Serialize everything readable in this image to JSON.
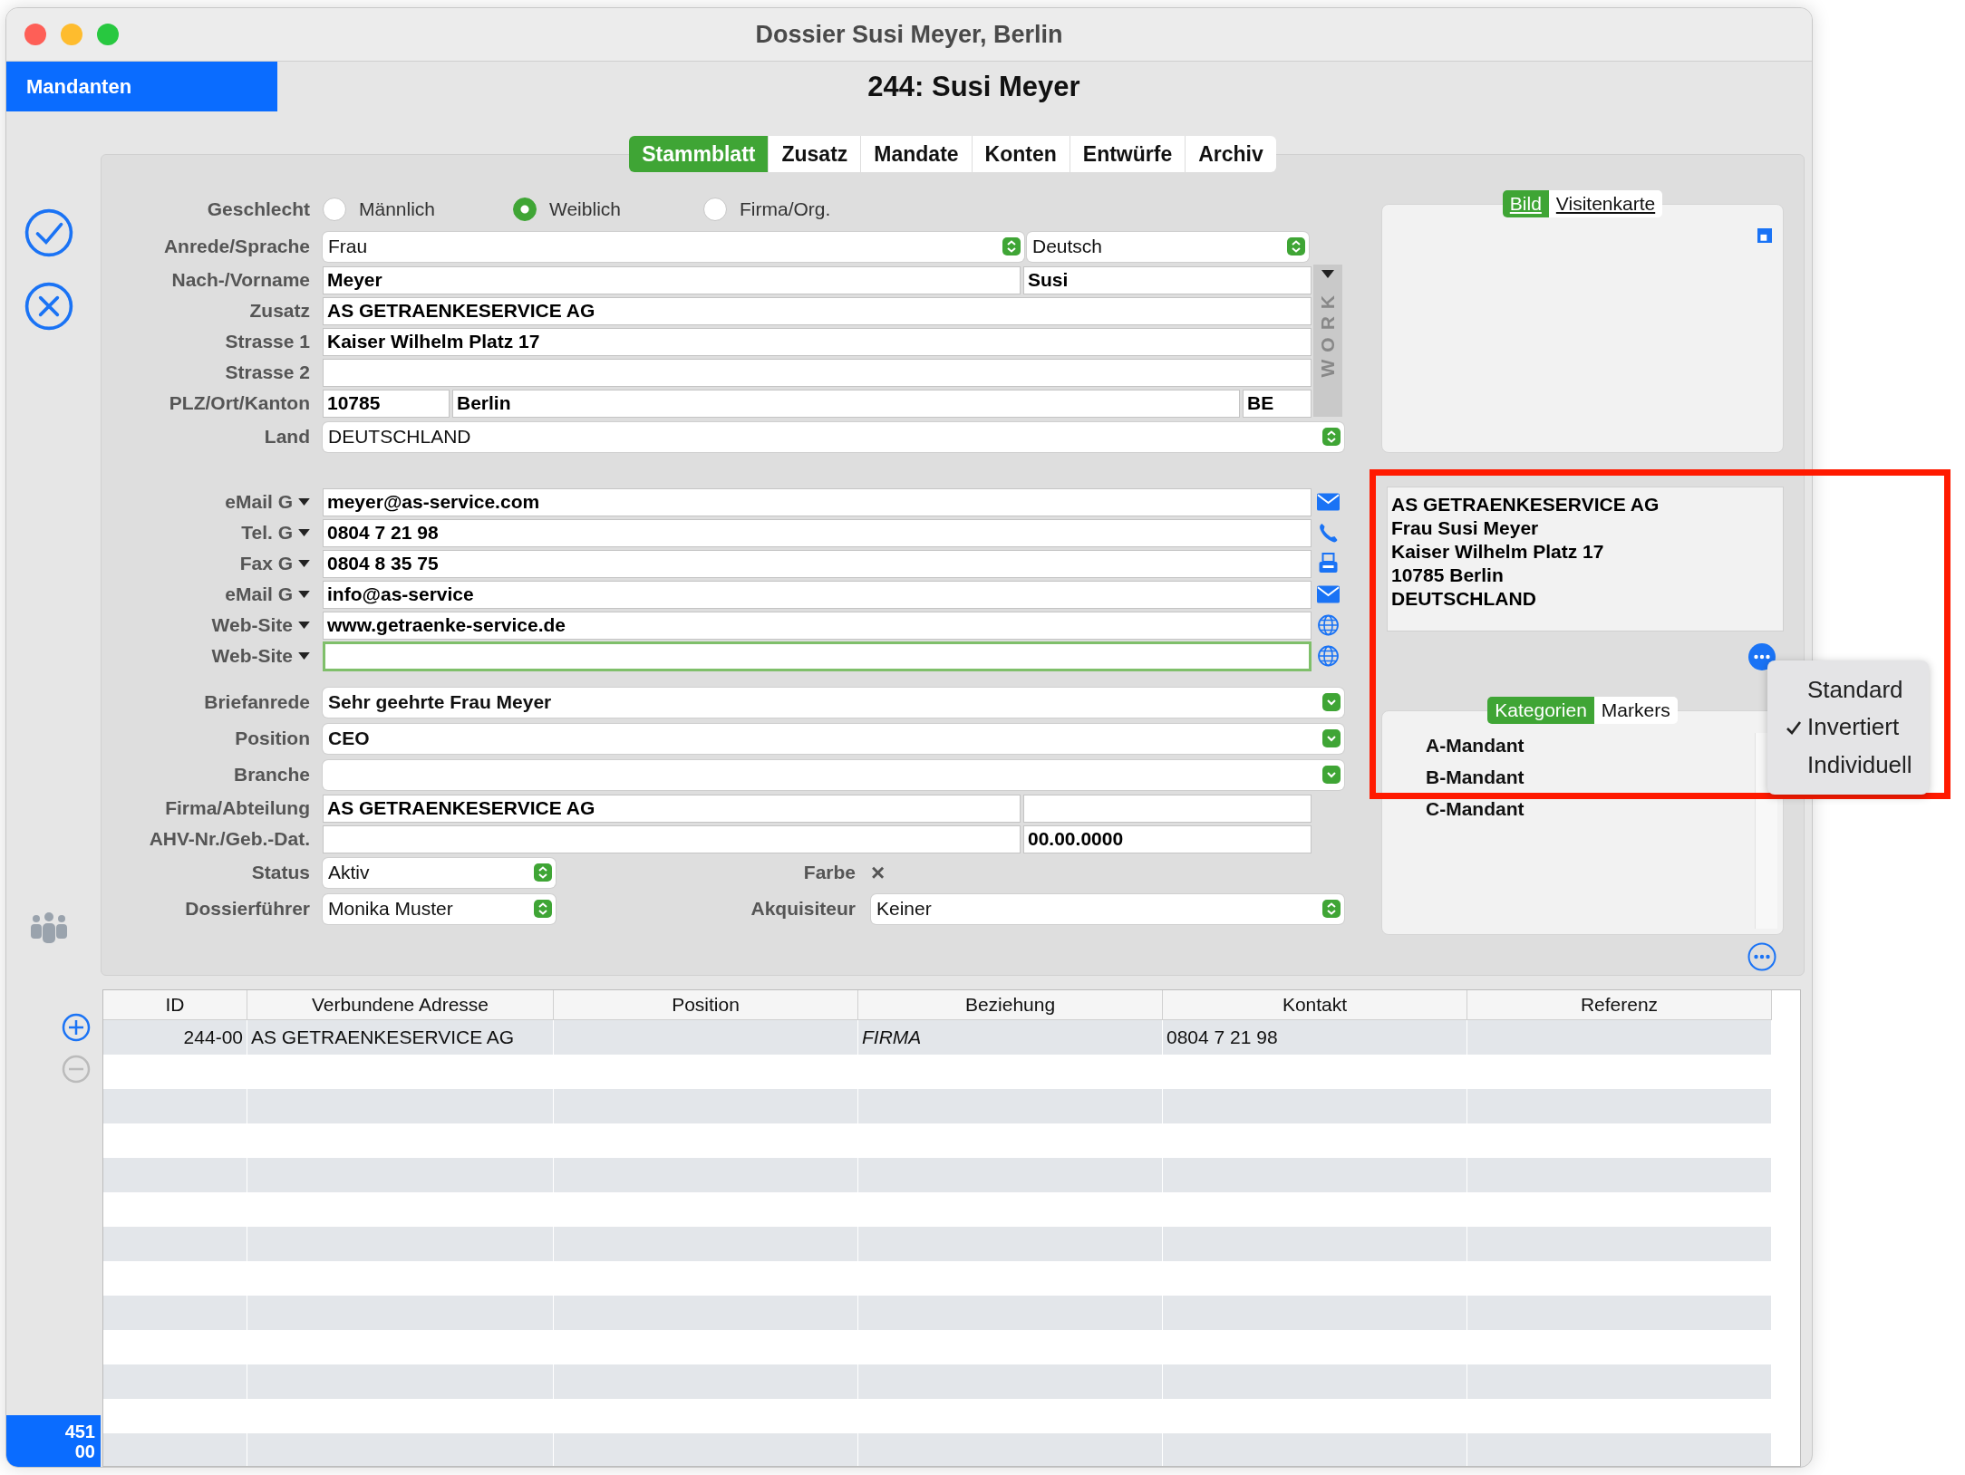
{
  "window": {
    "title": "Dossier Susi Meyer, Berlin"
  },
  "sidebar": {
    "section": "Mandanten",
    "counter": [
      "451",
      "00"
    ]
  },
  "heading": "244: Susi Meyer",
  "tabs": [
    {
      "label": "Stammblatt",
      "selected": true
    },
    {
      "label": "Zusatz",
      "selected": false
    },
    {
      "label": "Mandate",
      "selected": false
    },
    {
      "label": "Konten",
      "selected": false
    },
    {
      "label": "Entwürfe",
      "selected": false
    },
    {
      "label": "Archiv",
      "selected": false
    }
  ],
  "gender": {
    "label": "Geschlecht",
    "options": [
      {
        "label": "Männlich",
        "selected": false
      },
      {
        "label": "Weiblich",
        "selected": true
      },
      {
        "label": "Firma/Org.",
        "selected": false
      }
    ]
  },
  "address_rows": [
    {
      "kind": "select-pair",
      "label": "Anrede/Sprache",
      "value": "Frau",
      "value_2": "Deutsch"
    },
    {
      "kind": "text-pair",
      "label": "Nach-/Vorname",
      "value": "Meyer",
      "value_2": "Susi"
    },
    {
      "kind": "text",
      "label": "Zusatz",
      "value": "AS GETRAENKESERVICE AG"
    },
    {
      "kind": "text",
      "label": "Strasse 1",
      "value": "Kaiser Wilhelm Platz 17"
    },
    {
      "kind": "text",
      "label": "Strasse 2"
    },
    {
      "kind": "zip-city",
      "label": "PLZ/Ort/Kanton",
      "value": "10785",
      "value_2": "Berlin",
      "value_3": "BE"
    },
    {
      "kind": "select",
      "label": "Land",
      "value": "DEUTSCHLAND",
      "bold": false
    }
  ],
  "address_tag": "WORK",
  "contact_rows": [
    {
      "kind": "mail",
      "label": "eMail G",
      "value": "meyer@as-service.com",
      "focused": false
    },
    {
      "kind": "phone",
      "label": "Tel. G",
      "value": "0804 7 21 98",
      "focused": false
    },
    {
      "kind": "fax",
      "label": "Fax G",
      "value": "0804 8 35 75",
      "focused": false
    },
    {
      "kind": "mail",
      "label": "eMail G",
      "value": "info@as-service",
      "focused": false
    },
    {
      "kind": "web",
      "label": "Web-Site",
      "value": "www.getraenke-service.de",
      "focused": false
    },
    {
      "kind": "web",
      "label": "Web-Site",
      "focused": true
    }
  ],
  "detail_rows": [
    {
      "kind": "combo",
      "label": "Briefanrede",
      "value": "Sehr geehrte Frau Meyer",
      "bold": true
    },
    {
      "kind": "combo",
      "label": "Position",
      "value": "CEO",
      "bold": true
    },
    {
      "kind": "combo",
      "label": "Branche"
    },
    {
      "kind": "text-pair",
      "label": "Firma/Abteilung",
      "value": "AS GETRAENKESERVICE AG"
    },
    {
      "kind": "text-pair",
      "label": "AHV-Nr./Geb.-Dat.",
      "value_2": "00.00.0000"
    },
    {
      "kind": "select-mark",
      "label": "Status",
      "value": "Aktiv",
      "label_2": "Farbe",
      "mark": "×"
    },
    {
      "kind": "select-select",
      "label": "Dossierführer",
      "value": "Monika Muster",
      "label_2": "Akquisiteur",
      "value_2": "Keiner"
    }
  ],
  "picture_tabs": [
    {
      "label": "Bild",
      "selected": true
    },
    {
      "label": "Visitenkarte",
      "selected": false
    }
  ],
  "address_block": [
    "AS GETRAENKESERVICE AG",
    "Frau Susi Meyer",
    "Kaiser Wilhelm Platz 17",
    "10785 Berlin",
    "DEUTSCHLAND"
  ],
  "category_tabs": [
    {
      "label": "Kategorien",
      "selected": true
    },
    {
      "label": "Markers",
      "selected": false
    }
  ],
  "categories": [
    "A-Mandant",
    "B-Mandant",
    "C-Mandant"
  ],
  "popup_menu": [
    {
      "label": "Standard",
      "checked": false
    },
    {
      "label": "Invertiert",
      "checked": true
    },
    {
      "label": "Individuell",
      "checked": false
    }
  ],
  "table": {
    "columns": [
      "ID",
      "Verbundene Adresse",
      "Position",
      "Beziehung",
      "Kontakt",
      "Referenz"
    ],
    "rows": [
      {
        "id": "244-00",
        "address": "AS GETRAENKESERVICE AG",
        "relation": "FIRMA",
        "contact": "0804 7 21 98"
      }
    ]
  }
}
